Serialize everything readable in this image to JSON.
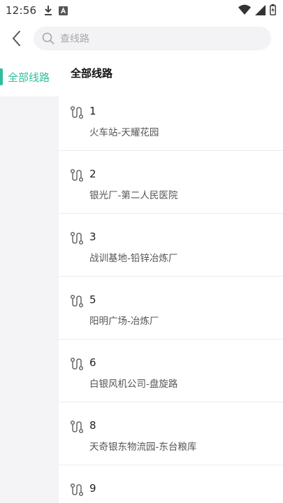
{
  "status_bar": {
    "time": "12:56",
    "icons": [
      "download-icon",
      "a-box-icon",
      "wifi-icon",
      "signal-icon",
      "battery-icon"
    ]
  },
  "header": {
    "back_icon": "chevron-left-icon",
    "search_placeholder": "查线路"
  },
  "sidebar": {
    "items": [
      {
        "label": "全部线路",
        "selected": true
      }
    ],
    "accent_color": "#2dbf9c"
  },
  "main": {
    "section_title": "全部线路",
    "routes": [
      {
        "number": "1",
        "name": "火车站-天耀花园"
      },
      {
        "number": "2",
        "name": "银光厂-第二人民医院"
      },
      {
        "number": "3",
        "name": "战训基地-铅锌冶炼厂"
      },
      {
        "number": "5",
        "name": "阳明广场-冶炼厂"
      },
      {
        "number": "6",
        "name": "白银风机公司-盘旋路"
      },
      {
        "number": "8",
        "name": "天奇银东物流园-东台粮库"
      },
      {
        "number": "9",
        "name": ""
      }
    ]
  }
}
